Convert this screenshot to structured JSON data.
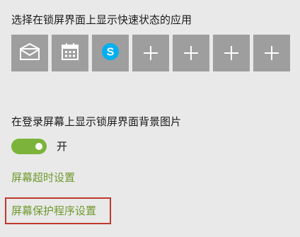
{
  "quick_status": {
    "heading": "选择在锁屏界面上显示快速状态的应用",
    "tiles": [
      {
        "icon": "mail-icon"
      },
      {
        "icon": "calendar-icon"
      },
      {
        "icon": "skype-icon",
        "letter": "S"
      },
      {
        "icon": "plus-icon"
      },
      {
        "icon": "plus-icon"
      },
      {
        "icon": "plus-icon"
      },
      {
        "icon": "plus-icon"
      }
    ]
  },
  "signin_background": {
    "heading": "在登录屏幕上显示锁屏界面背景图片",
    "toggle_state": "开",
    "toggle_on": true
  },
  "links": {
    "screen_timeout": "屏幕超时设置",
    "screen_saver": "屏幕保护程序设置"
  },
  "colors": {
    "background": "#e9e9e9",
    "tile": "#9e9e9e",
    "accent_green": "#7cb33a",
    "link_green": "#6f9a2e",
    "highlight_red": "#c0392b",
    "skype_blue": "#00aff0"
  }
}
